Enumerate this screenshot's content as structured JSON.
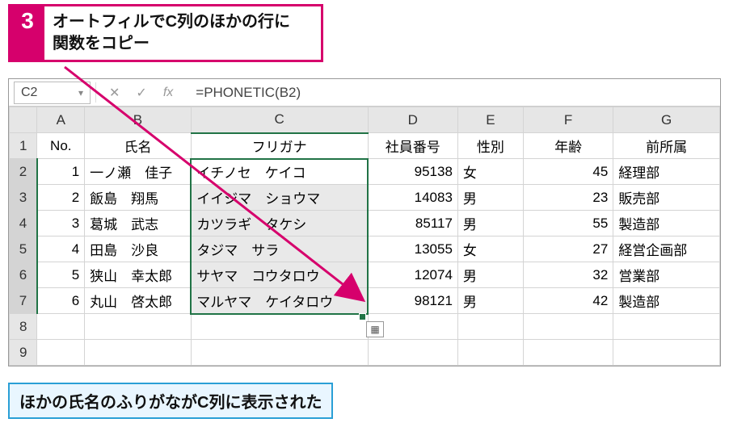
{
  "callout1": {
    "num": "3",
    "text": "オートフィルでC列のほかの行に\n関数をコピー"
  },
  "callout2": {
    "text": "ほかの氏名のふりがながC列に表示された"
  },
  "nameBox": "C2",
  "formula": "=PHONETIC(B2)",
  "columns": [
    "A",
    "B",
    "C",
    "D",
    "E",
    "F",
    "G"
  ],
  "headers": {
    "A": "No.",
    "B": "氏名",
    "C": "フリガナ",
    "D": "社員番号",
    "E": "性別",
    "F": "年齢",
    "G": "前所属"
  },
  "rows": [
    {
      "no": "1",
      "name": "一ノ瀬　佳子",
      "kana": "イチノセ　ケイコ",
      "id": "95138",
      "sex": "女",
      "age": "45",
      "dept": "経理部"
    },
    {
      "no": "2",
      "name": "飯島　翔馬",
      "kana": "イイジマ　ショウマ",
      "id": "14083",
      "sex": "男",
      "age": "23",
      "dept": "販売部"
    },
    {
      "no": "3",
      "name": "葛城　武志",
      "kana": "カツラギ　タケシ",
      "id": "85117",
      "sex": "男",
      "age": "55",
      "dept": "製造部"
    },
    {
      "no": "4",
      "name": "田島　沙良",
      "kana": "タジマ　サラ",
      "id": "13055",
      "sex": "女",
      "age": "27",
      "dept": "経営企画部"
    },
    {
      "no": "5",
      "name": "狭山　幸太郎",
      "kana": "サヤマ　コウタロウ",
      "id": "12074",
      "sex": "男",
      "age": "32",
      "dept": "営業部"
    },
    {
      "no": "6",
      "name": "丸山　啓太郎",
      "kana": "マルヤマ　ケイタロウ",
      "id": "98121",
      "sex": "男",
      "age": "42",
      "dept": "製造部"
    }
  ],
  "btnCancel": "✕",
  "btnEnter": "✓",
  "btnFx": "fx",
  "autofillGlyph": "▦"
}
